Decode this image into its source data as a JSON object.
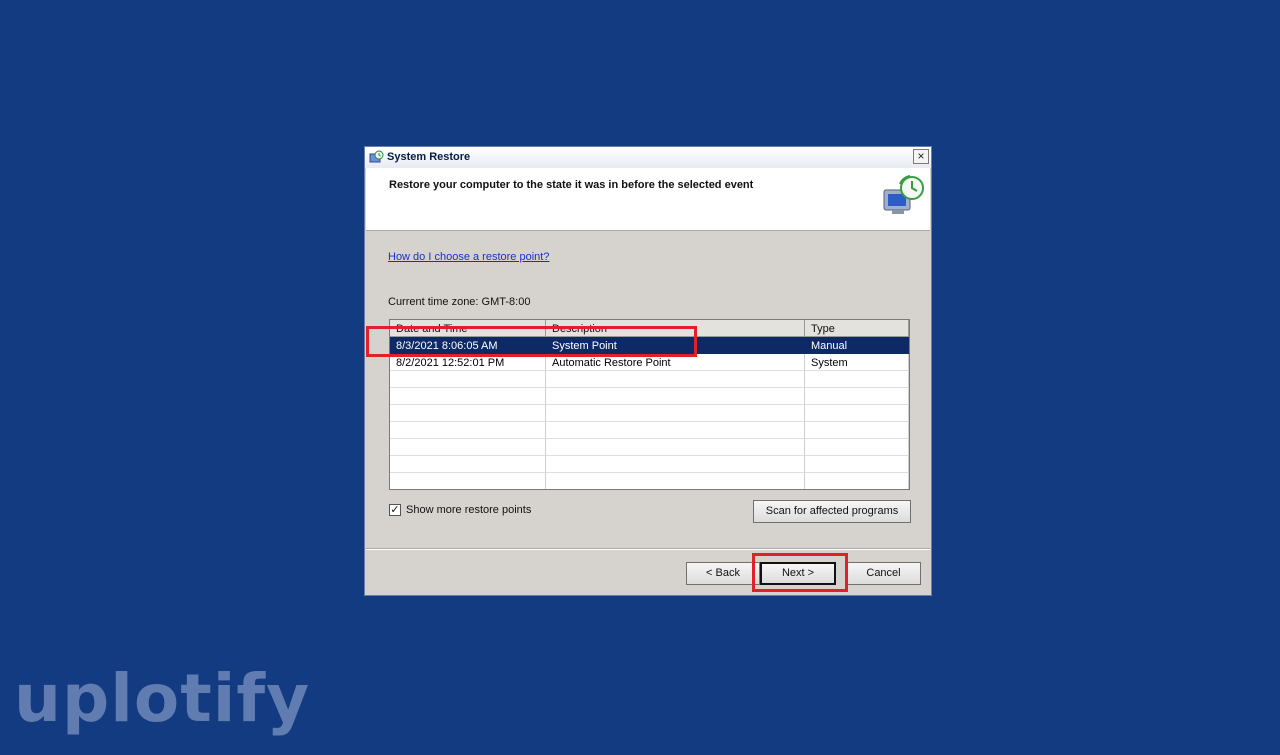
{
  "window": {
    "title": "System Restore",
    "close_glyph": "×"
  },
  "header": {
    "text": "Restore your computer to the state it was in before the selected event",
    "icon": "system-restore-icon"
  },
  "help_link": "How do I choose a restore point?",
  "timezone": "Current time zone: GMT-8:00",
  "table": {
    "columns": [
      "Date and Time",
      "Description",
      "Type"
    ],
    "rows": [
      {
        "date": "8/3/2021 8:06:05 AM",
        "description": "System Point",
        "type": "Manual",
        "selected": true
      },
      {
        "date": "8/2/2021 12:52:01 PM",
        "description": "Automatic Restore Point",
        "type": "System",
        "selected": false
      }
    ]
  },
  "show_more": {
    "label": "Show more restore points",
    "checked": true,
    "check_glyph": "✓"
  },
  "buttons": {
    "scan": "Scan for affected programs",
    "back": "< Back",
    "next": "Next >",
    "cancel": "Cancel"
  },
  "watermark": "uplotify",
  "colors": {
    "desktop": "#133b82",
    "selection": "#0d2a66",
    "annotation": "#e0212a",
    "link": "#1b2fc4"
  }
}
